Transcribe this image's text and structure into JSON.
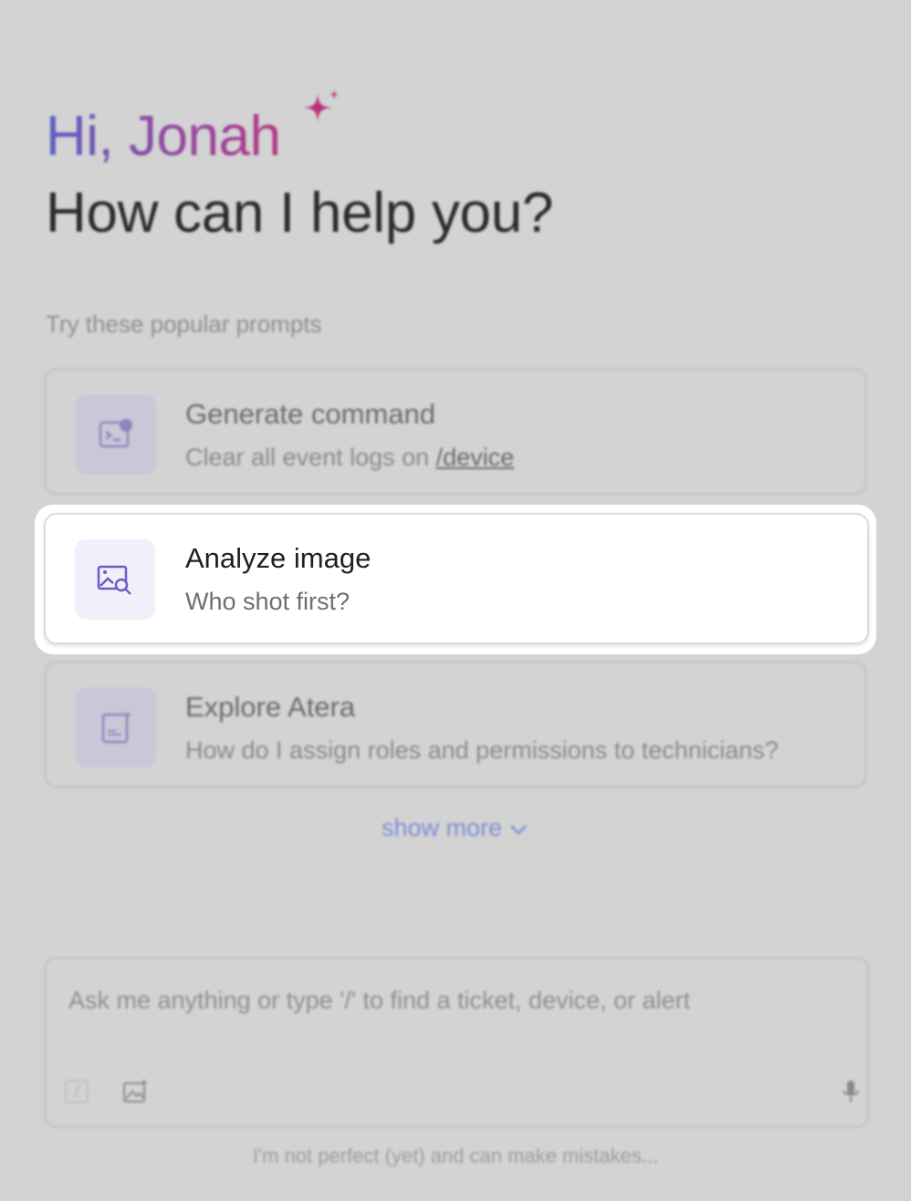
{
  "greeting": "Hi, Jonah",
  "headline": "How can I help you?",
  "prompts_label": "Try these popular prompts",
  "prompts": [
    {
      "title": "Generate command",
      "subtitle_prefix": "Clear all event logs on ",
      "subtitle_link": "/device",
      "icon": "terminal-icon"
    },
    {
      "title": "Analyze image",
      "subtitle": "Who shot first?",
      "icon": "image-search-icon"
    },
    {
      "title": "Explore Atera",
      "subtitle": "How do I assign roles and permissions to technicians?",
      "icon": "document-sparkle-icon"
    }
  ],
  "show_more": "show more",
  "input": {
    "placeholder": "Ask me anything or type '/' to find a ticket, device, or alert"
  },
  "footer_note": "I'm not perfect (yet) and can make mistakes...",
  "colors": {
    "accent": "#6b5fc7",
    "gradient_start": "#5a5fc6",
    "gradient_end": "#b23a86",
    "link": "#7f8ed6"
  }
}
